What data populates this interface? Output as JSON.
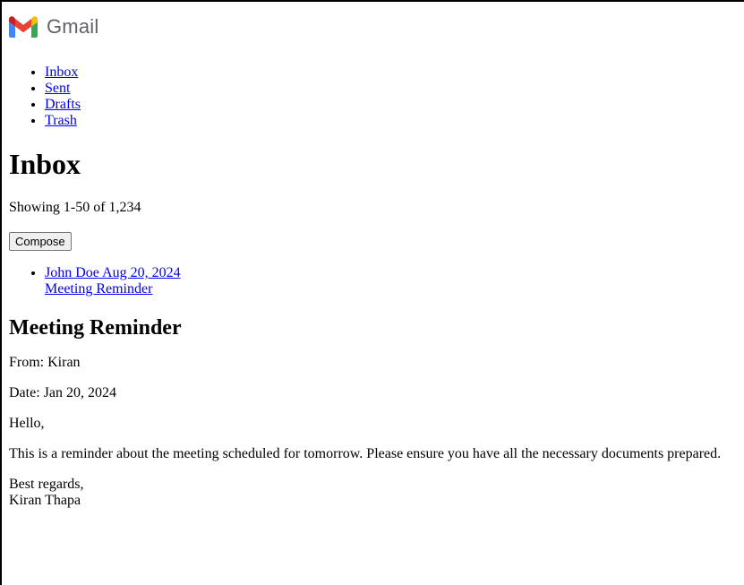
{
  "brand": {
    "name": "Gmail",
    "colors": {
      "red": "#EA4335",
      "blue": "#4285F4",
      "green": "#34A853",
      "yellow": "#FBBC04",
      "darkred": "#C5221F"
    }
  },
  "nav": {
    "items": [
      {
        "label": "Inbox"
      },
      {
        "label": "Sent"
      },
      {
        "label": "Drafts"
      },
      {
        "label": "Trash"
      }
    ]
  },
  "main": {
    "title": "Inbox",
    "count_text": "Showing 1-50 of 1,234",
    "compose_label": "Compose"
  },
  "mail_list": [
    {
      "sender": "John Doe",
      "date": "Aug 20, 2024",
      "subject": "Meeting Reminder"
    }
  ],
  "message": {
    "subject": "Meeting Reminder",
    "from_line": "From: Kiran",
    "date_line": "Date: Jan 20, 2024",
    "greeting": "Hello,",
    "body": "This is a reminder about the meeting scheduled for tomorrow. Please ensure you have all the necessary documents prepared.",
    "signoff": "Best regards,",
    "signature": "Kiran Thapa"
  }
}
